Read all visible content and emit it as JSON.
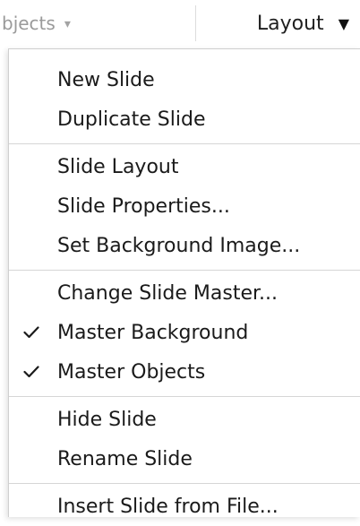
{
  "toolbar": {
    "objects_label": "bjects",
    "objects_caret": "▾",
    "layout_label": "Layout",
    "layout_caret": "▼"
  },
  "menu": {
    "items": [
      {
        "label": "New Slide",
        "checked": false
      },
      {
        "label": "Duplicate Slide",
        "checked": false
      },
      {
        "label": "Slide Layout",
        "checked": false
      },
      {
        "label": "Slide Properties...",
        "checked": false
      },
      {
        "label": "Set Background Image...",
        "checked": false
      },
      {
        "label": "Change Slide Master...",
        "checked": false
      },
      {
        "label": "Master Background",
        "checked": true
      },
      {
        "label": "Master Objects",
        "checked": true
      },
      {
        "label": "Hide Slide",
        "checked": false
      },
      {
        "label": "Rename Slide",
        "checked": false
      },
      {
        "label": "Insert Slide from File...",
        "checked": false
      }
    ]
  },
  "icons": {
    "checkmark": "check-icon"
  }
}
